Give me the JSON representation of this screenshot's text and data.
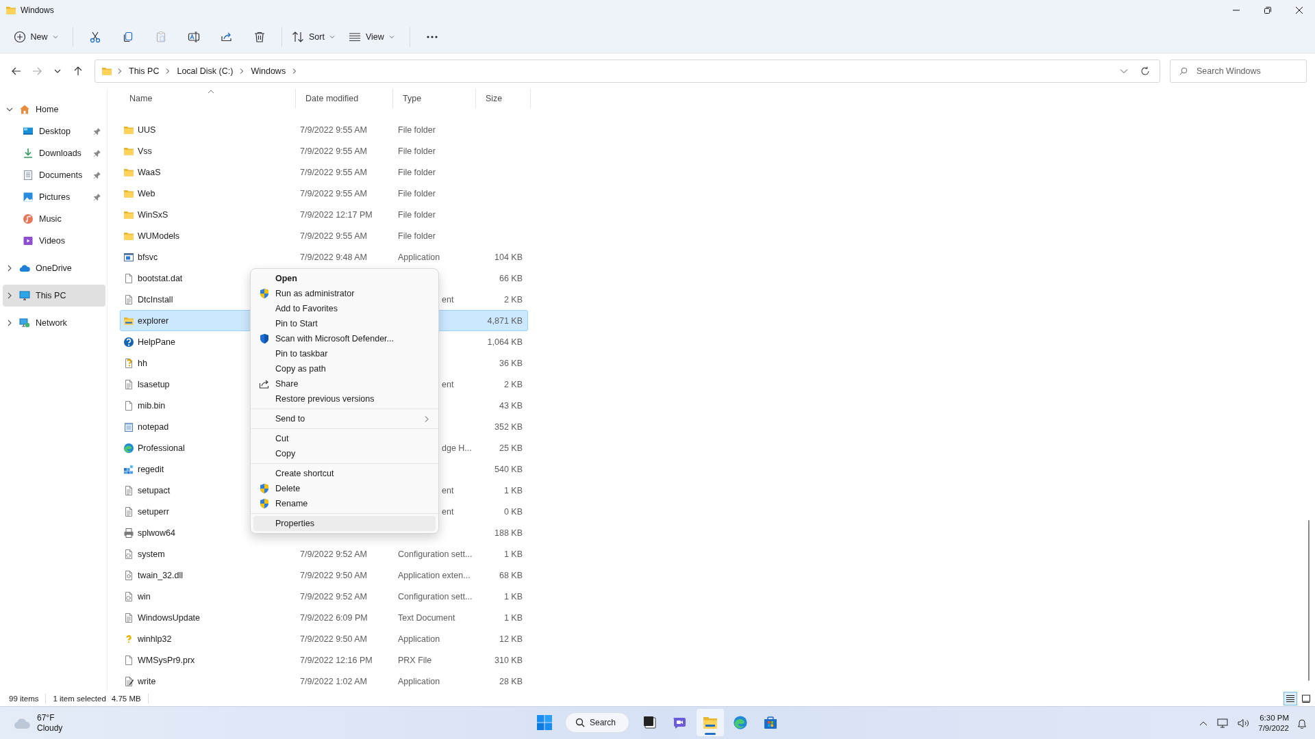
{
  "window": {
    "title": "Windows"
  },
  "toolbar": [
    {
      "kind": "dropdown",
      "label": "New"
    },
    {
      "kind": "separator"
    },
    {
      "kind": "button",
      "disabled": false
    },
    {
      "kind": "button",
      "disabled": false
    },
    {
      "kind": "button",
      "disabled": true
    },
    {
      "kind": "button",
      "disabled": false
    },
    {
      "kind": "button",
      "disabled": false
    },
    {
      "kind": "button",
      "disabled": false
    },
    {
      "kind": "separator"
    },
    {
      "kind": "dropdown",
      "label": "Sort"
    },
    {
      "kind": "dropdown",
      "label": "View"
    },
    {
      "kind": "separator"
    },
    {
      "kind": "more"
    }
  ],
  "navigation_buttons": [
    {
      "disabled": false
    },
    {
      "disabled": true
    },
    {
      "disabled": false
    },
    {
      "disabled": false
    }
  ],
  "address_bar": {
    "breadcrumbs": [
      "This PC",
      "Local Disk (C:)",
      "Windows"
    ]
  },
  "search": {
    "placeholder": "Search Windows"
  },
  "sidebar": {
    "items": [
      {
        "kind": "home",
        "label": "Home",
        "expanded": true,
        "selected": false,
        "children": [
          {
            "kind": "desktop",
            "label": "Desktop",
            "pinned": true,
            "selected": false
          },
          {
            "kind": "downloads",
            "label": "Downloads",
            "pinned": true,
            "selected": false
          },
          {
            "kind": "documents",
            "label": "Documents",
            "pinned": true,
            "selected": false
          },
          {
            "kind": "pictures",
            "label": "Pictures",
            "pinned": true,
            "selected": false
          },
          {
            "kind": "music",
            "label": "Music",
            "pinned": false,
            "selected": false
          },
          {
            "kind": "videos",
            "label": "Videos",
            "pinned": false,
            "selected": false
          }
        ]
      },
      {
        "kind": "onedrive",
        "label": "OneDrive",
        "expanded": false,
        "selected": false
      },
      {
        "kind": "pc",
        "label": "This PC",
        "expanded": false,
        "selected": true
      },
      {
        "kind": "network",
        "label": "Network",
        "expanded": false,
        "selected": false
      }
    ]
  },
  "table": {
    "columns": [
      {
        "label": "Name",
        "sorted": true
      },
      {
        "label": "Date modified",
        "sorted": false
      },
      {
        "label": "Type",
        "sorted": false
      },
      {
        "label": "Size",
        "sorted": false
      }
    ],
    "rows": [
      {
        "kind": "folder",
        "name": "UUS",
        "date": "7/9/2022 9:55 AM",
        "type": "File folder",
        "selected": false
      },
      {
        "kind": "folder",
        "name": "Vss",
        "date": "7/9/2022 9:55 AM",
        "type": "File folder",
        "selected": false
      },
      {
        "kind": "folder",
        "name": "WaaS",
        "date": "7/9/2022 9:55 AM",
        "type": "File folder",
        "selected": false
      },
      {
        "kind": "folder",
        "name": "Web",
        "date": "7/9/2022 9:55 AM",
        "type": "File folder",
        "selected": false
      },
      {
        "kind": "folder",
        "name": "WinSxS",
        "date": "7/9/2022 12:17 PM",
        "type": "File folder",
        "selected": false
      },
      {
        "kind": "folder",
        "name": "WUModels",
        "date": "7/9/2022 9:55 AM",
        "type": "File folder",
        "selected": false
      },
      {
        "kind": "app",
        "name": "bfsvc",
        "date": "7/9/2022 9:48 AM",
        "type": "Application",
        "size": "104 KB",
        "selected": false
      },
      {
        "kind": "file",
        "name": "bootstat.dat",
        "size": "66 KB",
        "selected": false
      },
      {
        "kind": "text",
        "name": "DtcInstall",
        "type_tail": "ent",
        "size": "2 KB",
        "selected": false
      },
      {
        "kind": "explorer",
        "name": "explorer",
        "size": "4,871 KB",
        "selected": true
      },
      {
        "kind": "help",
        "name": "HelpPane",
        "size": "1,064 KB",
        "selected": false
      },
      {
        "kind": "helpfile",
        "name": "hh",
        "size": "36 KB",
        "selected": false
      },
      {
        "kind": "text",
        "name": "lsasetup",
        "type_tail": "ent",
        "size": "2 KB",
        "selected": false
      },
      {
        "kind": "file",
        "name": "mib.bin",
        "size": "43 KB",
        "selected": false
      },
      {
        "kind": "notepad",
        "name": "notepad",
        "size": "352 KB",
        "selected": false
      },
      {
        "kind": "edge",
        "name": "Professional",
        "type_tail": "dge H...",
        "size": "25 KB",
        "selected": false
      },
      {
        "kind": "registry",
        "name": "regedit",
        "size": "540 KB",
        "selected": false
      },
      {
        "kind": "text",
        "name": "setupact",
        "type_tail": "ent",
        "size": "1 KB",
        "selected": false
      },
      {
        "kind": "text",
        "name": "setuperr",
        "type_tail": "ent",
        "size": "0 KB",
        "selected": false
      },
      {
        "kind": "printer",
        "name": "splwow64",
        "size": "188 KB",
        "selected": false
      },
      {
        "kind": "config",
        "name": "system",
        "date": "7/9/2022 9:52 AM",
        "type": "Configuration sett...",
        "size": "1 KB",
        "selected": false
      },
      {
        "kind": "dll",
        "name": "twain_32.dll",
        "date": "7/9/2022 9:50 AM",
        "type": "Application exten...",
        "size": "68 KB",
        "selected": false
      },
      {
        "kind": "config",
        "name": "win",
        "date": "7/9/2022 9:52 AM",
        "type": "Configuration sett...",
        "size": "1 KB",
        "selected": false
      },
      {
        "kind": "text",
        "name": "WindowsUpdate",
        "date": "7/9/2022 6:09 PM",
        "type": "Text Document",
        "size": "1 KB",
        "selected": false
      },
      {
        "kind": "question",
        "name": "winhlp32",
        "date": "7/9/2022 9:50 AM",
        "type": "Application",
        "size": "12 KB",
        "selected": false
      },
      {
        "kind": "file",
        "name": "WMSysPr9.prx",
        "date": "7/9/2022 12:16 PM",
        "type": "PRX File",
        "size": "310 KB",
        "selected": false
      },
      {
        "kind": "write",
        "name": "write",
        "date": "7/9/2022 1:02 AM",
        "type": "Application",
        "size": "28 KB",
        "selected": false
      }
    ]
  },
  "context_menu": [
    {
      "kind": "item",
      "label": "Open",
      "default": true,
      "hovered": false
    },
    {
      "kind": "elevated",
      "label": "Run as administrator",
      "default": false,
      "hovered": false
    },
    {
      "kind": "item",
      "label": "Add to Favorites",
      "default": false,
      "hovered": false
    },
    {
      "kind": "item",
      "label": "Pin to Start",
      "default": false,
      "hovered": false
    },
    {
      "kind": "scan",
      "label": "Scan with Microsoft Defender...",
      "default": false,
      "hovered": false
    },
    {
      "kind": "item",
      "label": "Pin to taskbar",
      "default": false,
      "hovered": false
    },
    {
      "kind": "item",
      "label": "Copy as path",
      "default": false,
      "hovered": false
    },
    {
      "kind": "share",
      "label": "Share",
      "default": false,
      "hovered": false
    },
    {
      "kind": "item",
      "label": "Restore previous versions",
      "default": false,
      "hovered": false
    },
    {
      "kind": "separator"
    },
    {
      "kind": "submenu",
      "label": "Send to",
      "default": false,
      "hovered": false
    },
    {
      "kind": "separator"
    },
    {
      "kind": "item",
      "label": "Cut",
      "default": false,
      "hovered": false
    },
    {
      "kind": "item",
      "label": "Copy",
      "default": false,
      "hovered": false
    },
    {
      "kind": "separator"
    },
    {
      "kind": "item",
      "label": "Create shortcut",
      "default": false,
      "hovered": false
    },
    {
      "kind": "elevated",
      "label": "Delete",
      "default": false,
      "hovered": false
    },
    {
      "kind": "elevated",
      "label": "Rename",
      "default": false,
      "hovered": false
    },
    {
      "kind": "separator"
    },
    {
      "kind": "item",
      "label": "Properties",
      "default": false,
      "hovered": true
    }
  ],
  "status_bar": {
    "item_count": "99 items",
    "selection": "1 item selected",
    "selection_size": "4.75 MB",
    "views": [
      {
        "selected": true
      },
      {
        "selected": false
      }
    ]
  },
  "taskbar": {
    "weather": {
      "temperature": "67°F",
      "condition": "Cloudy"
    },
    "search": "Search",
    "apps": [
      {
        "kind": "taskview",
        "active": false
      },
      {
        "kind": "chat",
        "active": false
      },
      {
        "kind": "explorer",
        "active": true
      },
      {
        "kind": "edge",
        "active": false
      },
      {
        "kind": "store",
        "active": false
      }
    ],
    "time": "6:30 PM",
    "date": "7/9/2022"
  }
}
